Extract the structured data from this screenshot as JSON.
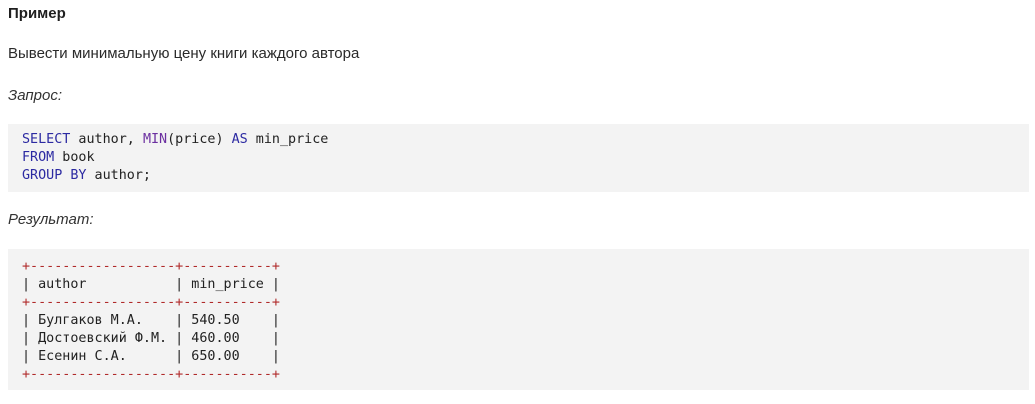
{
  "heading": "Пример",
  "description": "Вывести минимальную цену книги каждого автора",
  "query_label": "Запрос:",
  "result_label": "Результат:",
  "sql": {
    "line1": {
      "kw_select": "SELECT",
      "text_author": " author, ",
      "fn_min": "MIN",
      "text_arg": "(price) ",
      "kw_as": "AS",
      "text_alias": " min_price"
    },
    "line2": {
      "kw_from": "FROM",
      "text_table": " book"
    },
    "line3": {
      "kw_group_by": "GROUP BY",
      "text_rest": " author;"
    }
  },
  "result_table": {
    "border_line": "+------------------+-----------+",
    "header_row": "| author           | min_price |",
    "rows": [
      "| Булгаков М.А.    | 540.50    |",
      "| Достоевский Ф.М. | 460.00    |",
      "| Есенин С.А.      | 650.00    |"
    ]
  }
}
